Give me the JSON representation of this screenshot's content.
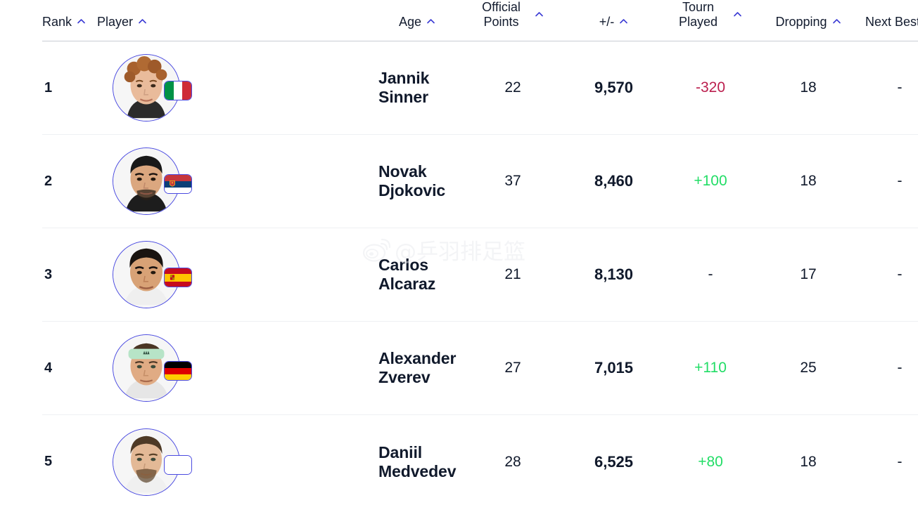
{
  "table": {
    "columns": [
      {
        "key": "rank",
        "label": "Rank",
        "sort_icon": "chevron-up-icon"
      },
      {
        "key": "player",
        "label": "Player",
        "sort_icon": "chevron-up-icon"
      },
      {
        "key": "age",
        "label": "Age",
        "sort_icon": "chevron-up-icon"
      },
      {
        "key": "points",
        "label": "Official Points",
        "label_line1": "Official",
        "label_line2": "Points",
        "sort_icon": "chevron-up-icon"
      },
      {
        "key": "plusminus",
        "label": "+/-",
        "sort_icon": "chevron-up-icon"
      },
      {
        "key": "tourn",
        "label": "Tourn Played",
        "label_line1": "Tourn",
        "label_line2": "Played",
        "sort_icon": "chevron-up-icon"
      },
      {
        "key": "dropping",
        "label": "Dropping",
        "sort_icon": "chevron-up-icon"
      },
      {
        "key": "nextbest",
        "label": "Next Best",
        "sort_icon": "chevron-up-icon"
      }
    ],
    "rows": [
      {
        "rank": "1",
        "name": "Jannik Sinner",
        "country": "Italy",
        "flag": "it",
        "age": "22",
        "points": "9,570",
        "plusminus": "-320",
        "plusminus_sign": "negative",
        "tourn": "18",
        "dropping": "-",
        "nextbest": "-"
      },
      {
        "rank": "2",
        "name": "Novak Djokovic",
        "country": "Serbia",
        "flag": "rs",
        "age": "37",
        "points": "8,460",
        "plusminus": "+100",
        "plusminus_sign": "positive",
        "tourn": "18",
        "dropping": "-",
        "nextbest": "-"
      },
      {
        "rank": "3",
        "name": "Carlos Alcaraz",
        "country": "Spain",
        "flag": "es",
        "age": "21",
        "points": "8,130",
        "plusminus": "-",
        "plusminus_sign": "none",
        "tourn": "17",
        "dropping": "-",
        "nextbest": "-"
      },
      {
        "rank": "4",
        "name": "Alexander Zverev",
        "country": "Germany",
        "flag": "de",
        "age": "27",
        "points": "7,015",
        "plusminus": "+110",
        "plusminus_sign": "positive",
        "tourn": "25",
        "dropping": "-",
        "nextbest": "-"
      },
      {
        "rank": "5",
        "name": "Daniil Medvedev",
        "country": "Neutral",
        "flag": "neutral",
        "age": "28",
        "points": "6,525",
        "plusminus": "+80",
        "plusminus_sign": "positive",
        "tourn": "18",
        "dropping": "-",
        "nextbest": "-"
      }
    ]
  },
  "watermark": {
    "logo": "weibo-logo-icon",
    "text": "@乒羽排足篮"
  },
  "colors": {
    "positive": "#22dd66",
    "negative": "#bb1f4e",
    "sort_icon": "#3b3bd4",
    "text": "#10192b",
    "avatar_ring": "#4a4ae0"
  }
}
